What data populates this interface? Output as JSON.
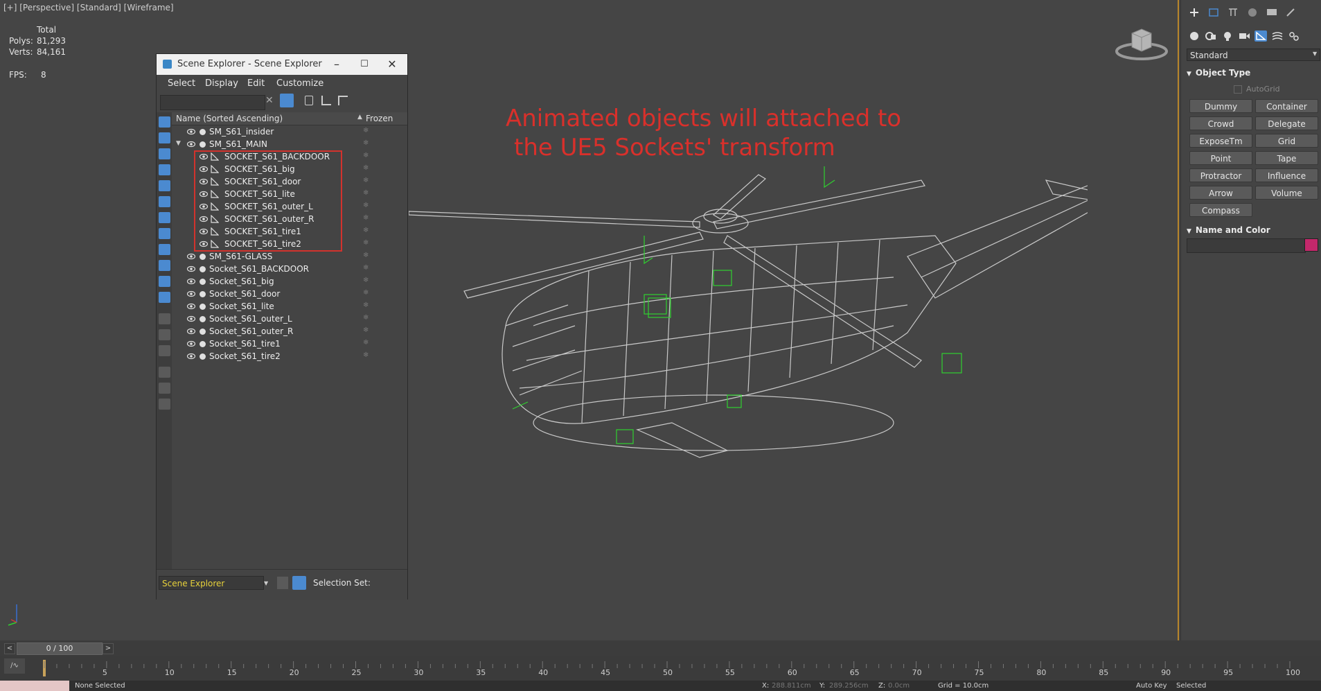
{
  "viewport": {
    "label": "[+] [Perspective] [Standard] [Wireframe]",
    "stats": {
      "total_label": "Total",
      "polys_label": "Polys:",
      "polys_value": "81,293",
      "verts_label": "Verts:",
      "verts_value": "84,161",
      "fps_label": "FPS:",
      "fps_value": "8"
    },
    "annotation_line1": "Animated objects will attached to",
    "annotation_line2": "the UE5 Sockets' transform"
  },
  "scene_explorer": {
    "title": "Scene Explorer - Scene Explorer",
    "menu": [
      "Select",
      "Display",
      "Edit",
      "Customize"
    ],
    "search_placeholder": "",
    "col_name": "Name (Sorted Ascending)",
    "col_frozen": "Frozen",
    "rows": [
      {
        "name": "SM_S61_insider",
        "level": 0
      },
      {
        "name": "SM_S61_MAIN",
        "level": 0,
        "expanded": true
      },
      {
        "name": "SOCKET_S61_BACKDOOR",
        "level": 1
      },
      {
        "name": "SOCKET_S61_big",
        "level": 1
      },
      {
        "name": "SOCKET_S61_door",
        "level": 1
      },
      {
        "name": "SOCKET_S61_lite",
        "level": 1
      },
      {
        "name": "SOCKET_S61_outer_L",
        "level": 1
      },
      {
        "name": "SOCKET_S61_outer_R",
        "level": 1
      },
      {
        "name": "SOCKET_S61_tire1",
        "level": 1
      },
      {
        "name": "SOCKET_S61_tire2",
        "level": 1
      },
      {
        "name": "SM_S61-GLASS",
        "level": 0
      },
      {
        "name": "Socket_S61_BACKDOOR",
        "level": 0
      },
      {
        "name": "Socket_S61_big",
        "level": 0
      },
      {
        "name": "Socket_S61_door",
        "level": 0
      },
      {
        "name": "Socket_S61_lite",
        "level": 0
      },
      {
        "name": "Socket_S61_outer_L",
        "level": 0
      },
      {
        "name": "Socket_S61_outer_R",
        "level": 0
      },
      {
        "name": "Socket_S61_tire1",
        "level": 0
      },
      {
        "name": "Socket_S61_tire2",
        "level": 0
      }
    ],
    "bottom_dropdown": "Scene Explorer",
    "selection_set_label": "Selection Set:"
  },
  "command_panel": {
    "category": "Standard",
    "object_type_title": "Object Type",
    "autogrid": "AutoGrid",
    "buttons": [
      "Dummy",
      "Container",
      "Crowd",
      "Delegate",
      "ExposeTm",
      "Grid",
      "Point",
      "Tape",
      "Protractor",
      "Influence",
      "Arrow",
      "Volume",
      "Compass"
    ],
    "name_color_title": "Name and Color",
    "object_color": "#c4286b"
  },
  "timeline": {
    "frame_display": "0 / 100",
    "ticks": [
      "5",
      "10",
      "15",
      "20",
      "25",
      "30",
      "35",
      "40",
      "45",
      "50",
      "55",
      "60",
      "65",
      "70",
      "75",
      "80",
      "85",
      "90",
      "95",
      "100"
    ],
    "status_text": "None Selected",
    "x_label": "X:",
    "x_value": "288.811cm",
    "y_label": "Y:",
    "y_value": "289.256cm",
    "z_label": "Z:",
    "z_value": "0.0cm",
    "grid_text": "Grid = 10.0cm",
    "auto_key": "Auto Key",
    "selected_dropdown": "Selected"
  },
  "colors": {
    "wireframe": "#d8d8d8",
    "socket_helpers": "#2fd12f",
    "annotation": "#d9302b",
    "highlight_box": "#d2322d",
    "viewport_border": "#b8862b"
  }
}
